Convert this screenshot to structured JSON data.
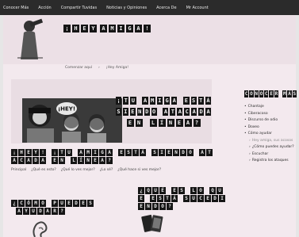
{
  "nav": {
    "items": [
      "Conocer Más",
      "Acción",
      "Compartir Tuvidas",
      "Noticias y Opiniones",
      "Acerca De",
      "Mr Account"
    ]
  },
  "header": {
    "title": "¡HEY AMIGA!"
  },
  "breadcrumb": {
    "home": "Comenzar aquí",
    "current": "¡Hey Amiga!"
  },
  "hero": {
    "bubble": "¡HEY!",
    "lines": [
      "¡TU AMIGA ESTÁ",
      "SIENDO ATACADA",
      "EN LÍNEA?"
    ]
  },
  "main": {
    "heading": "¡HEY! ¡TU AMIGA ESTÁ SIENDO ATACADA EN LÍNEA?",
    "subnav": [
      "Principal",
      "¿Qué es esto?",
      "¿Qué lo ves mejor?",
      "¿Lo sé?",
      "¿Qué hace si ves mejor?"
    ],
    "help_heading": "¿CÓMO PUEDES AYUDAR?",
    "happening_heading": "¿QUÉ ES LO QUE ESTÁ SUCEDIENDO?"
  },
  "sidebar": {
    "title": "CONOCER MÁS",
    "links": [
      {
        "label": "Chantaje",
        "sub": false,
        "muted": false
      },
      {
        "label": "Ciberacoso",
        "sub": false,
        "muted": false
      },
      {
        "label": "Discurso de odio",
        "sub": false,
        "muted": false
      },
      {
        "label": "Doxeo",
        "sub": false,
        "muted": false
      },
      {
        "label": "Cómo ayudar",
        "sub": false,
        "muted": false
      },
      {
        "label": "Hey amiga, sus acosos",
        "sub": true,
        "muted": true
      },
      {
        "label": "¿Cómo puedes ayudar?",
        "sub": true,
        "muted": false
      },
      {
        "label": "Escuchar",
        "sub": true,
        "muted": false
      },
      {
        "label": "Registra los ataques",
        "sub": true,
        "muted": false
      }
    ]
  }
}
